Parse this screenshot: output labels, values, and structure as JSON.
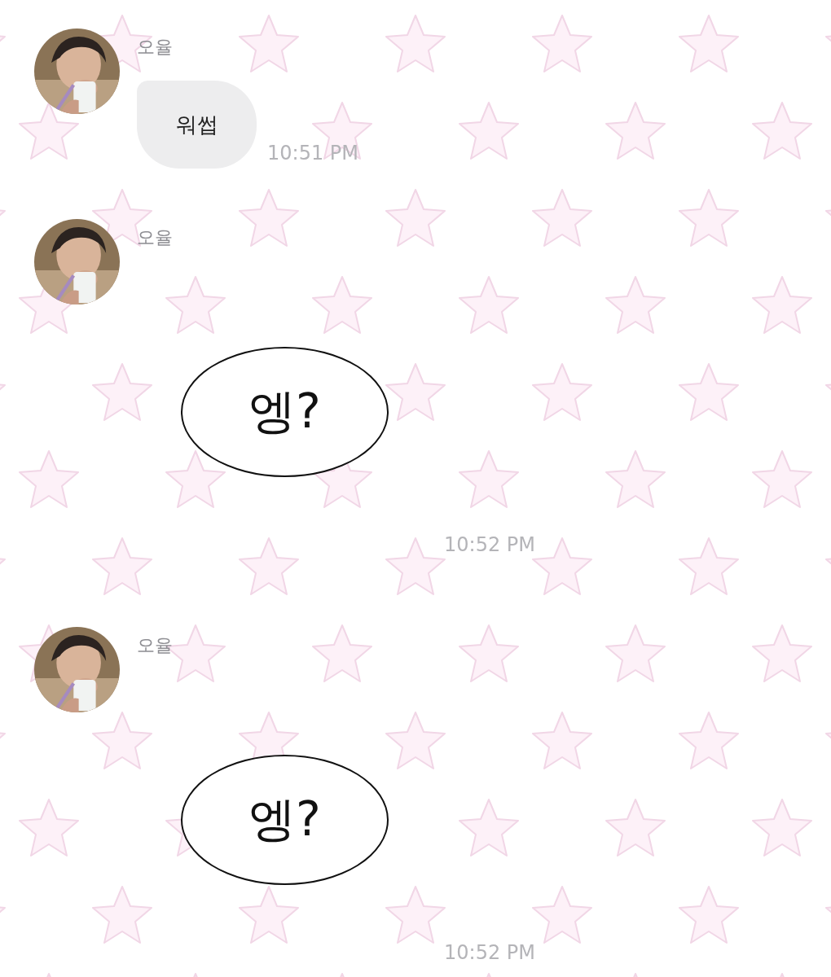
{
  "messages": [
    {
      "sender": "오율",
      "kind": "text",
      "text": "워썹",
      "time": "10:51 PM"
    },
    {
      "sender": "오율",
      "kind": "sticker",
      "text": "엥?",
      "time": "10:52 PM"
    },
    {
      "sender": "오율",
      "kind": "sticker",
      "text": "엥?",
      "time": "10:52 PM"
    }
  ]
}
